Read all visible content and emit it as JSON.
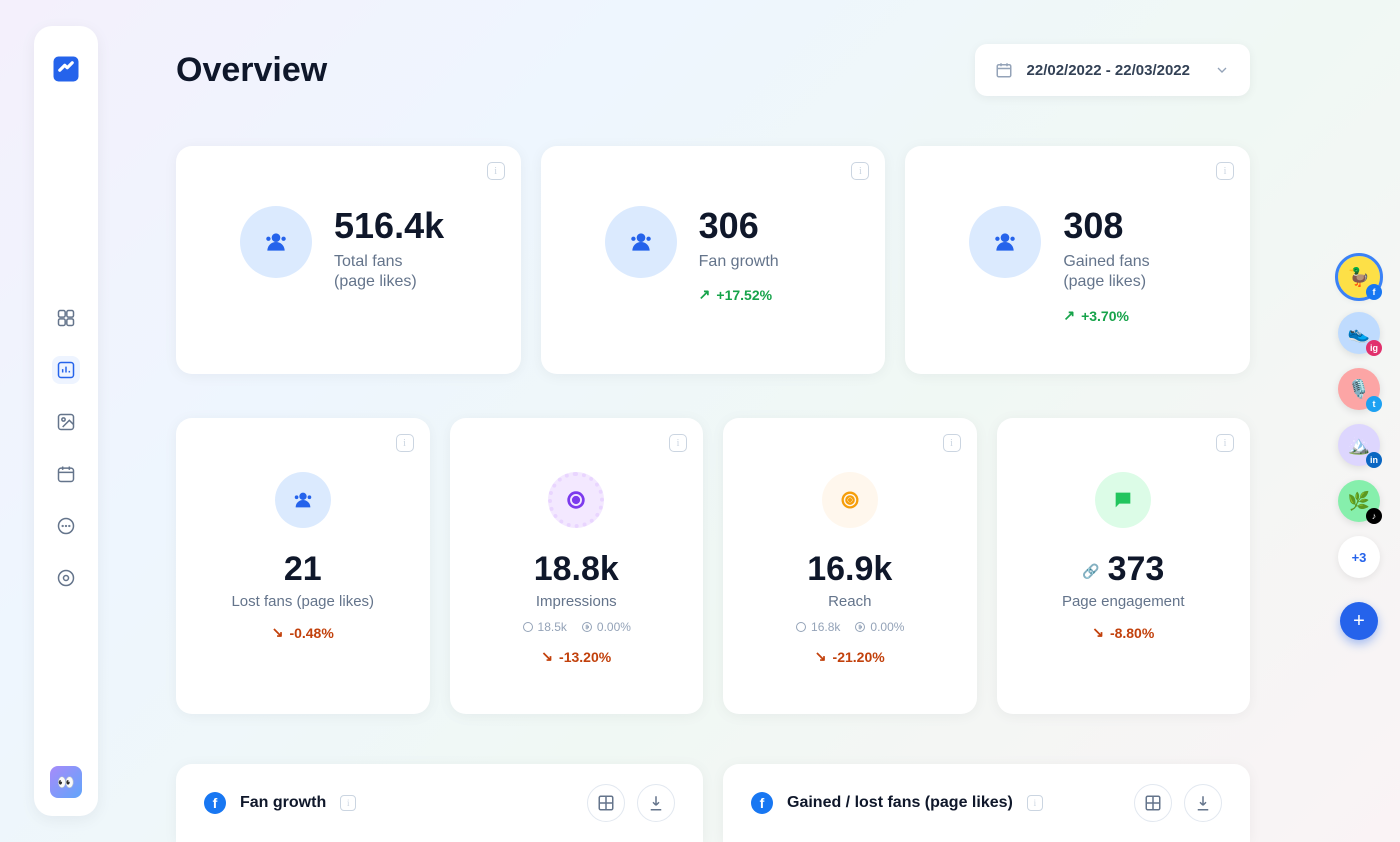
{
  "page_title": "Overview",
  "date_range": "22/02/2022 - 22/03/2022",
  "nav": {
    "items": [
      {
        "name": "dashboard-icon"
      },
      {
        "name": "analytics-icon",
        "active": true
      },
      {
        "name": "media-icon"
      },
      {
        "name": "calendar-icon"
      },
      {
        "name": "messages-icon"
      },
      {
        "name": "audience-icon"
      }
    ]
  },
  "metrics_top": [
    {
      "value": "516.4k",
      "label_line1": "Total fans",
      "label_line2": "(page likes)",
      "icon": "people-icon",
      "color": "blue",
      "growth": null
    },
    {
      "value": "306",
      "label_line1": "Fan growth",
      "label_line2": "",
      "icon": "people-icon",
      "color": "blue",
      "growth": {
        "dir": "up",
        "text": "+17.52%"
      }
    },
    {
      "value": "308",
      "label_line1": "Gained fans",
      "label_line2": "(page likes)",
      "icon": "people-icon",
      "color": "blue",
      "growth": {
        "dir": "up",
        "text": "+3.70%"
      }
    }
  ],
  "metrics_bottom": [
    {
      "value": "21",
      "label": "Lost fans (page likes)",
      "icon": "people-icon",
      "color": "blue",
      "growth": {
        "dir": "down",
        "text": "-0.48%"
      },
      "breakdown": null
    },
    {
      "value": "18.8k",
      "label": "Impressions",
      "icon": "eye-target-icon",
      "color": "purple",
      "growth": {
        "dir": "down",
        "text": "-13.20%"
      },
      "breakdown": {
        "organic": "18.5k",
        "paid": "0.00%"
      }
    },
    {
      "value": "16.9k",
      "label": "Reach",
      "icon": "target-icon",
      "color": "orange",
      "growth": {
        "dir": "down",
        "text": "-21.20%"
      },
      "breakdown": {
        "organic": "16.8k",
        "paid": "0.00%"
      }
    },
    {
      "value": "373",
      "label": "Page engagement",
      "icon": "chat-icon",
      "color": "green",
      "growth": {
        "dir": "down",
        "text": "-8.80%"
      },
      "prefix_icon": "link-icon",
      "breakdown": null
    }
  ],
  "sections": [
    {
      "title": "Fan growth"
    },
    {
      "title": "Gained / lost fans (page likes)"
    }
  ],
  "social_accounts": {
    "more_label": "+3",
    "items": [
      {
        "bg": "#fde047",
        "emoji": "🦆",
        "badge_bg": "#1877f2",
        "badge_text": "f",
        "selected": true,
        "name": "facebook-account-duck"
      },
      {
        "bg": "#bfdbfe",
        "emoji": "👟",
        "badge_bg": "#e1306c",
        "badge_text": "ig",
        "name": "instagram-account-shoe"
      },
      {
        "bg": "#fca5a5",
        "emoji": "🎙️",
        "badge_bg": "#1da1f2",
        "badge_text": "t",
        "name": "twitter-account-mic"
      },
      {
        "bg": "#ddd6fe",
        "emoji": "🏔️",
        "badge_bg": "#0a66c2",
        "badge_text": "in",
        "name": "linkedin-account-mountain"
      },
      {
        "bg": "#86efac",
        "emoji": "🌿",
        "badge_bg": "#000000",
        "badge_text": "♪",
        "name": "tiktok-account-leaf"
      }
    ]
  }
}
